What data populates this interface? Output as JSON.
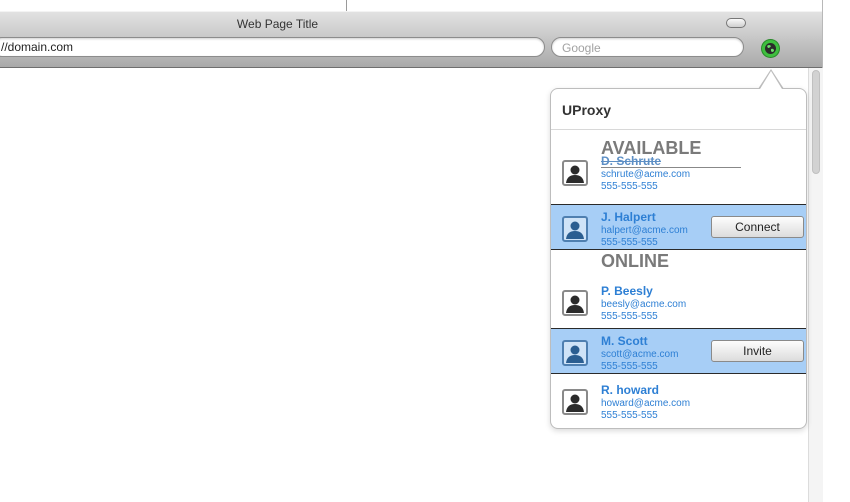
{
  "window": {
    "title": "Web Page Title",
    "address_value": "//domain.com",
    "search_placeholder": "Google"
  },
  "popover": {
    "title": "UProxy",
    "sections": {
      "available": "AVAILABLE",
      "online": "ONLINE"
    },
    "contacts": [
      {
        "name": "D. Schrute",
        "email": "schrute@acme.com",
        "phone": "555-555-555"
      },
      {
        "name": "J. Halpert",
        "email": "halpert@acme.com",
        "phone": "555-555-555",
        "action": "Connect"
      },
      {
        "name": "P. Beesly",
        "email": "beesly@acme.com",
        "phone": "555-555-555"
      },
      {
        "name": "M. Scott",
        "email": "scott@acme.com",
        "phone": "555-555-555",
        "action": "Invite"
      },
      {
        "name": "R. howard",
        "email": "howard@acme.com",
        "phone": "555-555-555"
      }
    ]
  },
  "colors": {
    "selection": "#a7cef6",
    "contact_text": "#2d7fd4",
    "extension_icon": "#3fbf3f"
  },
  "icons": {
    "extension": "uproxy-extension-icon",
    "avatar": "person-silhouette-icon"
  }
}
